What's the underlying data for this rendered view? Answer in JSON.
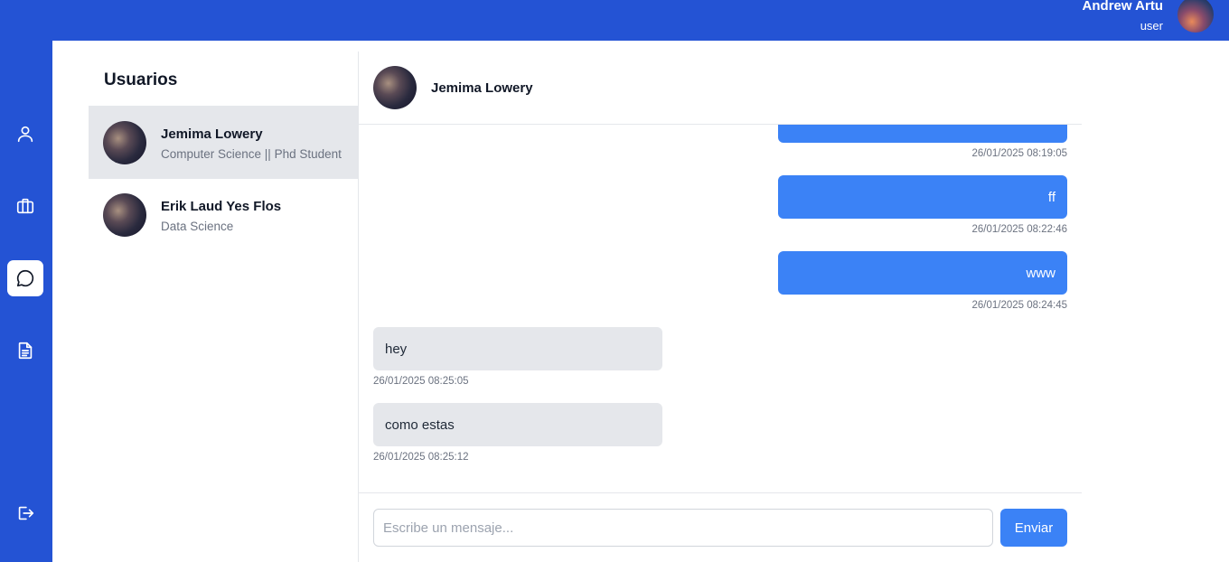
{
  "header": {
    "user_name": "Andrew Artu",
    "user_role": "user",
    "accent": "#2453d4"
  },
  "sidebar": {
    "items": [
      {
        "icon": "user-icon",
        "active": false
      },
      {
        "icon": "briefcase-icon",
        "active": false
      },
      {
        "icon": "chat-icon",
        "active": true
      },
      {
        "icon": "document-icon",
        "active": false
      },
      {
        "icon": "logout-icon",
        "active": false
      }
    ]
  },
  "users_panel": {
    "title": "Usuarios",
    "users": [
      {
        "name": "Jemima Lowery",
        "subtitle": "Computer Science || Phd Student",
        "selected": true
      },
      {
        "name": "Erik Laud Yes Flos",
        "subtitle": "Data Science",
        "selected": false
      }
    ]
  },
  "chat": {
    "contact_name": "Jemima Lowery",
    "messages": [
      {
        "direction": "out",
        "text": "",
        "timestamp": "26/01/2025 08:19:05"
      },
      {
        "direction": "out",
        "text": "ff",
        "timestamp": "26/01/2025 08:22:46"
      },
      {
        "direction": "out",
        "text": "www",
        "timestamp": "26/01/2025 08:24:45"
      },
      {
        "direction": "in",
        "text": "hey",
        "timestamp": "26/01/2025 08:25:05"
      },
      {
        "direction": "in",
        "text": "como estas",
        "timestamp": "26/01/2025 08:25:12"
      }
    ],
    "input_placeholder": "Escribe un mensaje...",
    "input_value": "",
    "send_label": "Enviar",
    "outgoing_color": "#3b82f6",
    "incoming_color": "#e5e7eb"
  }
}
